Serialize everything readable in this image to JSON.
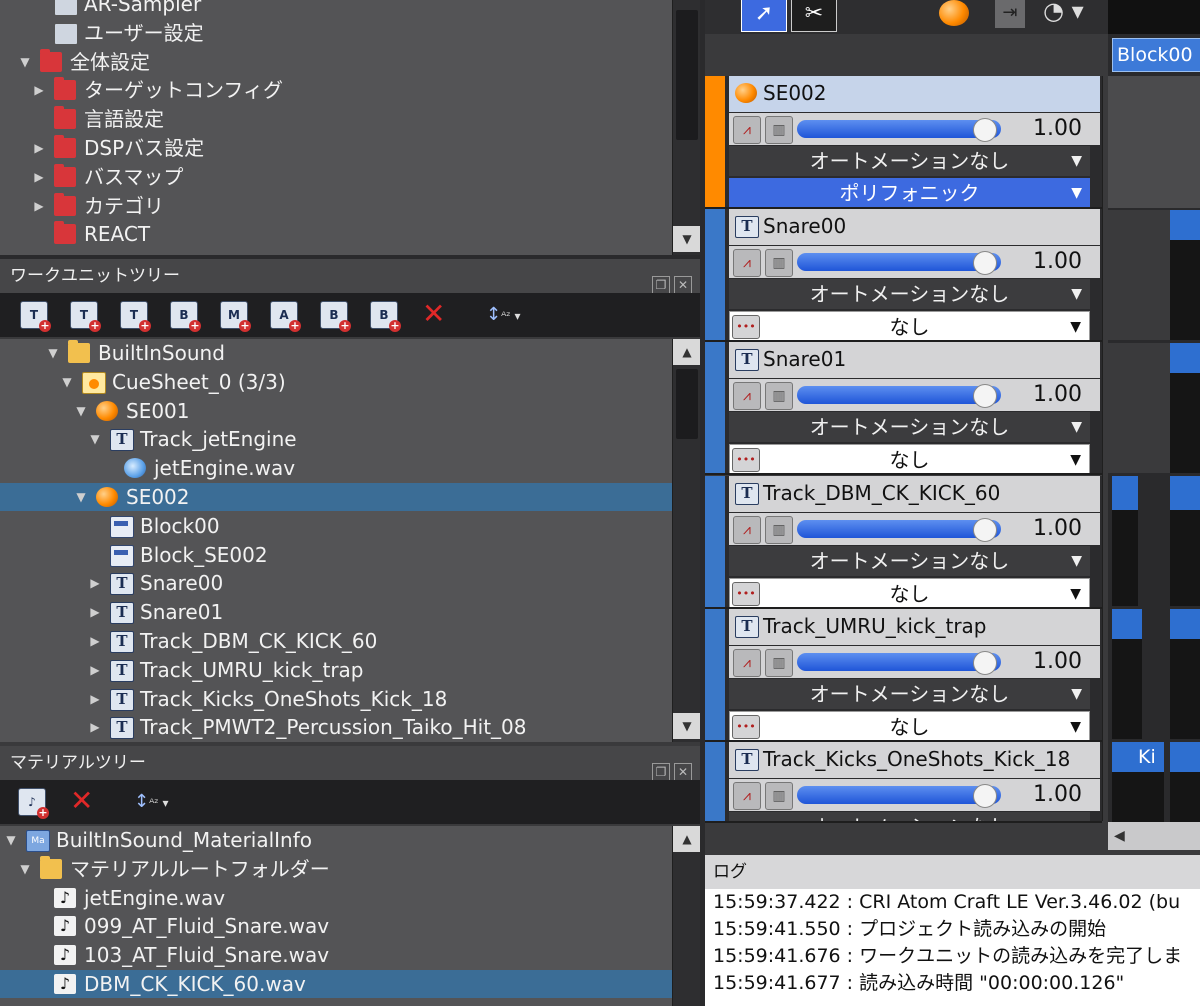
{
  "project_tree": {
    "items": [
      {
        "label": "AR-Sampler",
        "indent": 1,
        "icon": "cfg",
        "twist": ""
      },
      {
        "label": "ユーザー設定",
        "indent": 1,
        "icon": "cfg",
        "twist": ""
      },
      {
        "label": "全体設定",
        "indent": 0,
        "icon": "folder",
        "twist": "▼"
      },
      {
        "label": "ターゲットコンフィグ",
        "indent": 1,
        "icon": "folder",
        "twist": "▶"
      },
      {
        "label": "言語設定",
        "indent": 1,
        "icon": "folder",
        "twist": ""
      },
      {
        "label": "DSPバス設定",
        "indent": 1,
        "icon": "folder",
        "twist": "▶"
      },
      {
        "label": "バスマップ",
        "indent": 1,
        "icon": "folder",
        "twist": "▶"
      },
      {
        "label": "カテゴリ",
        "indent": 1,
        "icon": "folder",
        "twist": "▶"
      },
      {
        "label": "REACT",
        "indent": 1,
        "icon": "folder",
        "twist": ""
      }
    ]
  },
  "workunit": {
    "title": "ワークユニットツリー",
    "items": [
      {
        "label": "BuiltInSound",
        "indent": 0,
        "icon": "yfolder",
        "twist": "▼"
      },
      {
        "label": "CueSheet_0 (3/3)",
        "indent": 1,
        "icon": "cue",
        "twist": "▼"
      },
      {
        "label": "SE001",
        "indent": 2,
        "icon": "orb",
        "twist": "▼"
      },
      {
        "label": "Track_jetEngine",
        "indent": 3,
        "icon": "t",
        "twist": "▼"
      },
      {
        "label": "jetEngine.wav",
        "indent": 4,
        "icon": "wav",
        "twist": ""
      },
      {
        "label": "SE002",
        "indent": 2,
        "icon": "orb",
        "twist": "▼",
        "selected": true
      },
      {
        "label": "Block00",
        "indent": 3,
        "icon": "blk",
        "twist": ""
      },
      {
        "label": "Block_SE002",
        "indent": 3,
        "icon": "blk",
        "twist": ""
      },
      {
        "label": "Snare00",
        "indent": 3,
        "icon": "t",
        "twist": "▶"
      },
      {
        "label": "Snare01",
        "indent": 3,
        "icon": "t",
        "twist": "▶"
      },
      {
        "label": "Track_DBM_CK_KICK_60",
        "indent": 3,
        "icon": "t",
        "twist": "▶"
      },
      {
        "label": "Track_UMRU_kick_trap",
        "indent": 3,
        "icon": "t",
        "twist": "▶"
      },
      {
        "label": "Track_Kicks_OneShots_Kick_18",
        "indent": 3,
        "icon": "t",
        "twist": "▶"
      },
      {
        "label": "Track_PMWT2_Percussion_Taiko_Hit_08",
        "indent": 3,
        "icon": "t",
        "twist": "▶"
      }
    ]
  },
  "material": {
    "title": "マテリアルツリー",
    "items": [
      {
        "label": "BuiltInSound_MaterialInfo",
        "indent": 0,
        "icon": "ma",
        "twist": "▼"
      },
      {
        "label": "マテリアルルートフォルダー",
        "indent": 1,
        "icon": "yfolder",
        "twist": "▼"
      },
      {
        "label": "jetEngine.wav",
        "indent": 2,
        "icon": "note",
        "twist": ""
      },
      {
        "label": "099_AT_Fluid_Snare.wav",
        "indent": 2,
        "icon": "note",
        "twist": ""
      },
      {
        "label": "103_AT_Fluid_Snare.wav",
        "indent": 2,
        "icon": "note",
        "twist": ""
      },
      {
        "label": "DBM_CK_KICK_60.wav",
        "indent": 2,
        "icon": "note",
        "twist": "",
        "selected": true
      }
    ]
  },
  "toolbar_icons": [
    "T",
    "T",
    "T",
    "B",
    "M",
    "A",
    "B",
    "B"
  ],
  "tracks": [
    {
      "name": "SE002",
      "icon": "orb",
      "volume": "1.00",
      "volume_level": 0.92,
      "automation": "オートメーションなし",
      "mode": "ポリフォニック",
      "mode_style": "blue",
      "stripe": "#ff8a00",
      "header_bg": "#c6d4ea"
    },
    {
      "name": "Snare00",
      "icon": "t",
      "volume": "1.00",
      "volume_level": 0.92,
      "automation": "オートメーションなし",
      "mode": "なし",
      "mode_style": "white",
      "stripe": "#3a78c8",
      "header_bg": "#d4d4d6"
    },
    {
      "name": "Snare01",
      "icon": "t",
      "volume": "1.00",
      "volume_level": 0.92,
      "automation": "オートメーションなし",
      "mode": "なし",
      "mode_style": "white",
      "stripe": "#3a78c8",
      "header_bg": "#d4d4d6"
    },
    {
      "name": "Track_DBM_CK_KICK_60",
      "icon": "t",
      "volume": "1.00",
      "volume_level": 0.92,
      "automation": "オートメーションなし",
      "mode": "なし",
      "mode_style": "white",
      "stripe": "#3a78c8",
      "header_bg": "#d4d4d6"
    },
    {
      "name": "Track_UMRU_kick_trap",
      "icon": "t",
      "volume": "1.00",
      "volume_level": 0.92,
      "automation": "オートメーションなし",
      "mode": "なし",
      "mode_style": "white",
      "stripe": "#3a78c8",
      "header_bg": "#d4d4d6"
    },
    {
      "name": "Track_Kicks_OneShots_Kick_18",
      "icon": "t",
      "volume": "1.00",
      "volume_level": 0.92,
      "automation": "オートメーションなし",
      "mode": "",
      "mode_style": "white",
      "stripe": "#3a78c8",
      "header_bg": "#d4d4d6"
    }
  ],
  "timeline": {
    "block_label": "Block00",
    "clip_label": "Ki"
  },
  "log": {
    "title": "ログ",
    "lines": [
      "15:59:37.422 : CRI Atom Craft LE Ver.3.46.02 (bu",
      "15:59:41.550 : プロジェクト読み込みの開始",
      "15:59:41.676 : ワークユニットの読み込みを完了しま",
      "15:59:41.677 : 読み込み時間 \"00:00:00.126\""
    ]
  }
}
